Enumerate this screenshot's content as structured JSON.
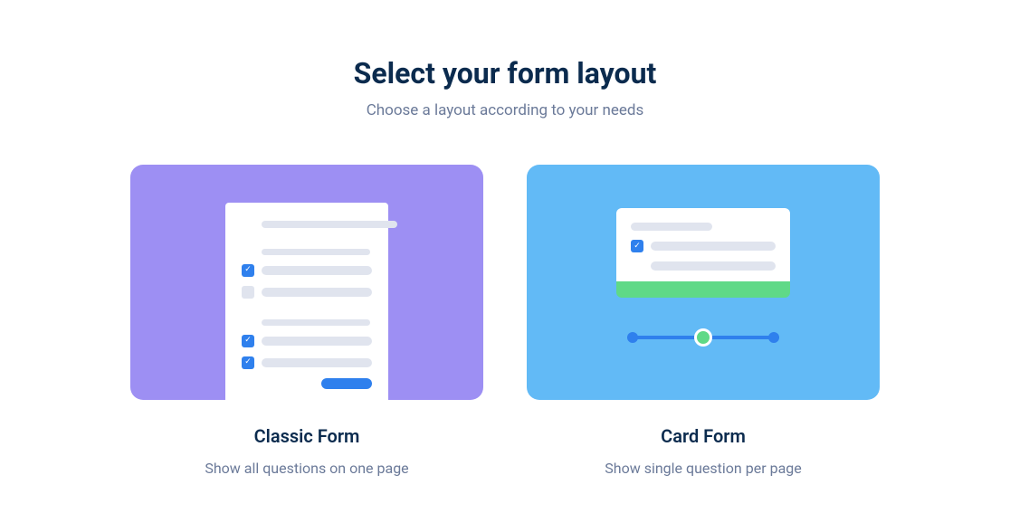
{
  "header": {
    "title": "Select your form layout",
    "subtitle": "Choose a layout according to your needs"
  },
  "options": [
    {
      "title": "Classic Form",
      "desc": "Show all questions on one page"
    },
    {
      "title": "Card Form",
      "desc": "Show single question per page"
    }
  ]
}
